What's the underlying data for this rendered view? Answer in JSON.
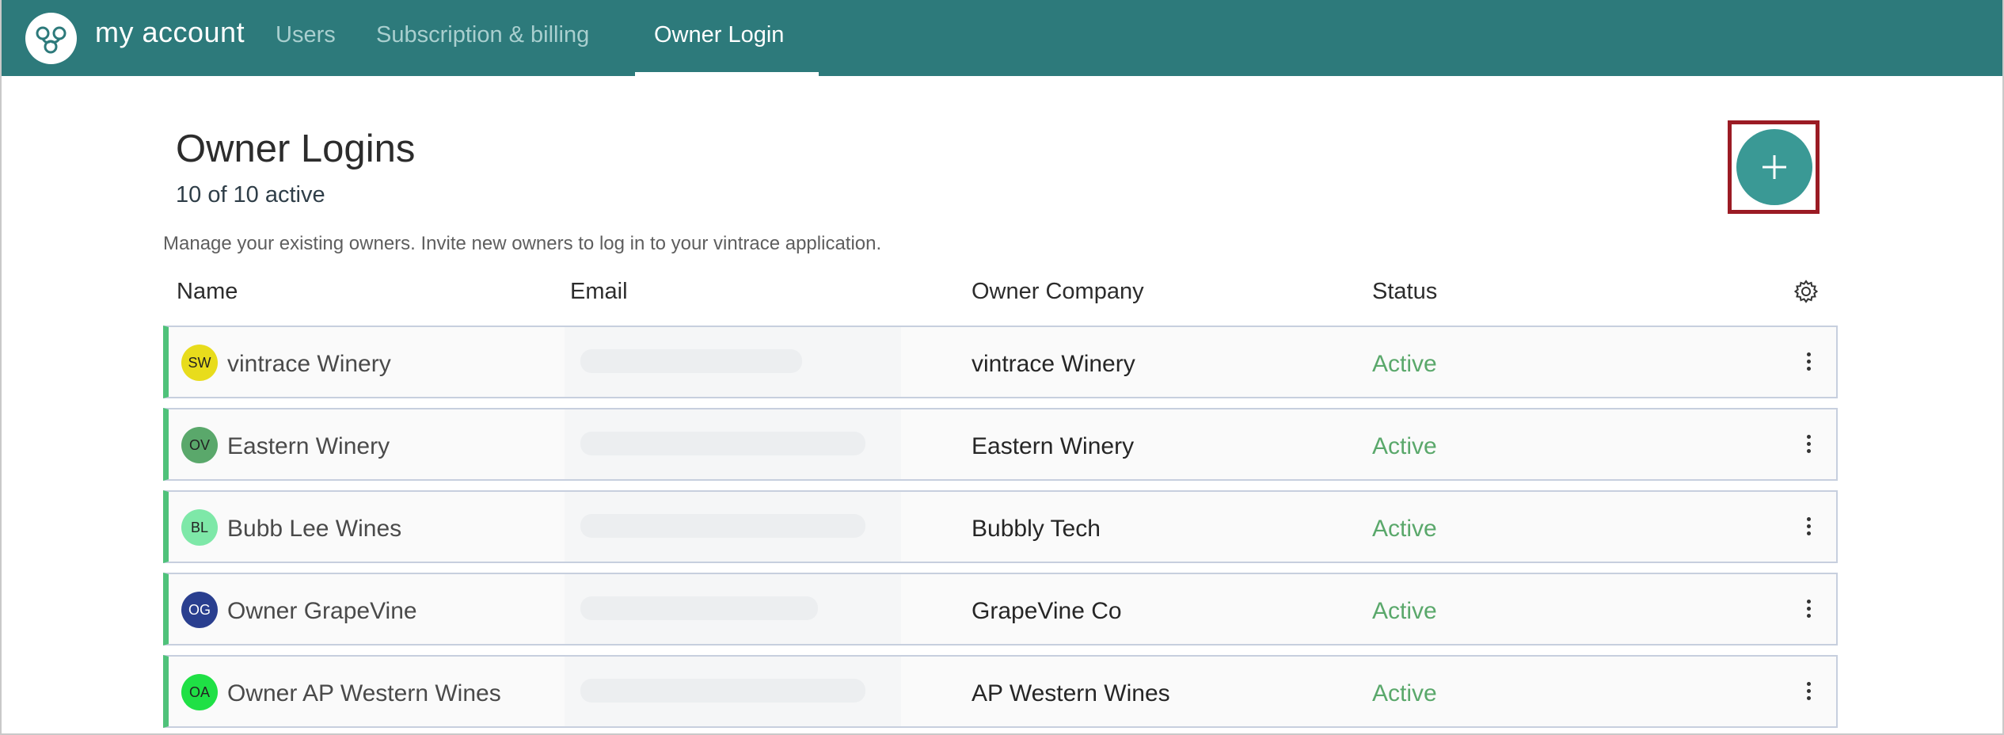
{
  "header": {
    "brand": "my account",
    "nav": [
      "Users",
      "Subscription & billing",
      "Owner Login"
    ],
    "active_tab": "Owner Login",
    "accent_color": "#2d7a7b"
  },
  "page": {
    "title": "Owner Logins",
    "count": "10 of 10 active",
    "description": "Manage your existing owners. Invite new owners to log in to your vintrace application.",
    "add_icon": "plus-icon"
  },
  "table": {
    "columns": [
      "Name",
      "Email",
      "Owner Company",
      "Status"
    ],
    "settings_icon": "gear-icon",
    "rows": [
      {
        "initials": "SW",
        "name": "vintrace Winery",
        "company": "vintrace Winery",
        "status": "Active",
        "avatar_color": "#e8dc1c"
      },
      {
        "initials": "OV",
        "name": "Eastern Winery",
        "company": "Eastern Winery",
        "status": "Active",
        "avatar_color": "#5aa86b"
      },
      {
        "initials": "BL",
        "name": "Bubb Lee Wines",
        "company": "Bubbly Tech",
        "status": "Active",
        "avatar_color": "#7ee8a8"
      },
      {
        "initials": "OG",
        "name": "Owner GrapeVine",
        "company": "GrapeVine Co",
        "status": "Active",
        "avatar_color": "#2a3f8f"
      },
      {
        "initials": "OA",
        "name": "Owner AP Western Wines",
        "company": "AP Western Wines",
        "status": "Active",
        "avatar_color": "#1fe045"
      }
    ]
  }
}
